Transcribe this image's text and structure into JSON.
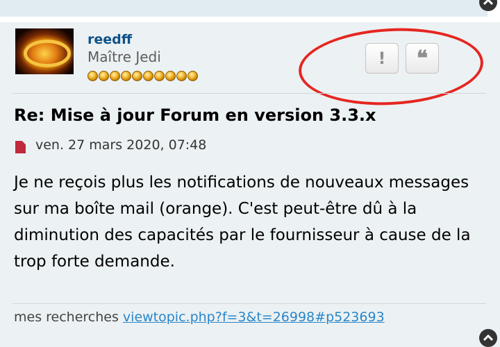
{
  "post": {
    "author": {
      "username": "reedff",
      "rank": "Maître Jedi",
      "rank_stars": 10,
      "avatar_icon": "ring-of-fire-avatar"
    },
    "actions": {
      "report_label": "!",
      "quote_label": "❝"
    },
    "title": "Re: Mise à jour Forum en version 3.3.x",
    "date": "ven. 27 mars 2020, 07:48",
    "body": "Je ne reçois plus les notifications de nouveaux messages sur ma boîte mail (orange). C'est peut-être dû à la diminution des capacités par le fournisseur à cause de la trop forte demande.",
    "signature": {
      "text": "mes recherches",
      "link": "viewtopic.php?f=3&t=26998#p523693"
    }
  },
  "colors": {
    "username": "#105289",
    "annotation_oval": "#e52620",
    "post_background": "#ecf1f3",
    "link": "#2a86c9"
  },
  "icons": {
    "post_icon": "post-document-icon",
    "report_icon": "report-icon",
    "quote_icon": "quote-icon",
    "scroll_top_icon": "chevron-up-icon"
  }
}
